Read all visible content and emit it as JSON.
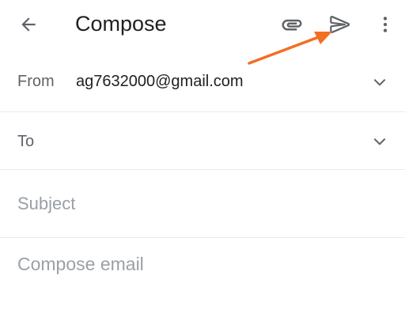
{
  "header": {
    "title": "Compose",
    "icons": {
      "back": "arrow-back-icon",
      "attach": "paperclip-icon",
      "send": "send-icon",
      "more": "more-vert-icon"
    }
  },
  "from": {
    "label": "From",
    "value": "ag7632000@gmail.com",
    "expand_icon": "chevron-down-icon"
  },
  "to": {
    "label": "To",
    "value": "",
    "expand_icon": "chevron-down-icon"
  },
  "subject": {
    "placeholder": "Subject",
    "value": ""
  },
  "body": {
    "placeholder": "Compose email",
    "value": ""
  },
  "annotation": {
    "type": "arrow",
    "points_to": "send-button",
    "color": "#f36f21"
  },
  "colors": {
    "icon": "#5f6368",
    "divider": "#e8eaed",
    "placeholder": "#9aa0a6"
  }
}
